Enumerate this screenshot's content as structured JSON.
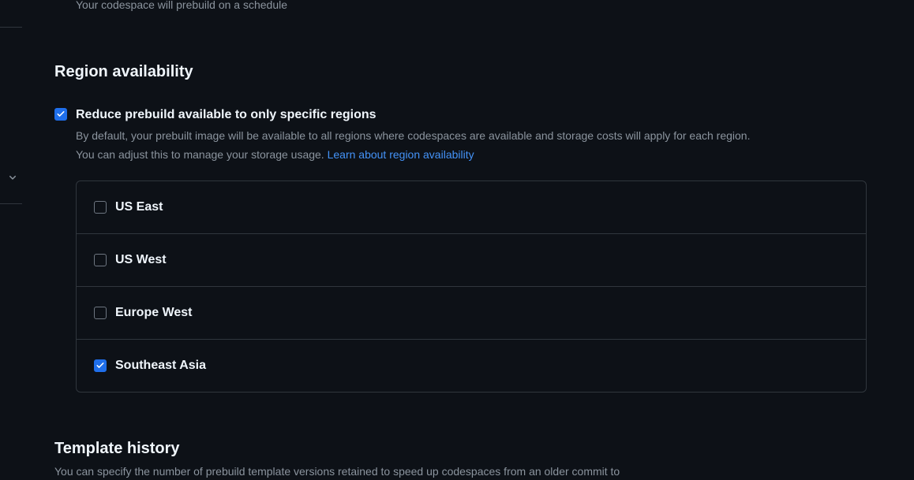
{
  "prebuild_tail_text": "Your codespace will prebuild on a schedule",
  "region": {
    "heading": "Region availability",
    "reduce_label": "Reduce prebuild available to only specific regions",
    "reduce_desc_line1": "By default, your prebuilt image will be available to all regions where codespaces are available and storage costs will apply for each region.",
    "reduce_desc_line2_prefix": "You can adjust this to manage your storage usage. ",
    "learn_link": "Learn about region availability",
    "options": [
      {
        "label": "US East",
        "checked": false
      },
      {
        "label": "US West",
        "checked": false
      },
      {
        "label": "Europe West",
        "checked": false
      },
      {
        "label": "Southeast Asia",
        "checked": true
      }
    ]
  },
  "template": {
    "heading": "Template history",
    "desc_partial": "You can specify the number of prebuild template versions retained to speed up codespaces from an older commit to"
  }
}
